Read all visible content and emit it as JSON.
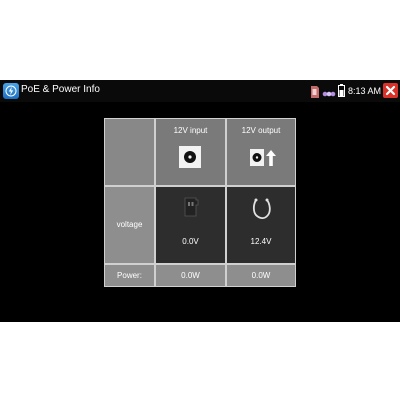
{
  "window": {
    "title": "PoE & Power Info"
  },
  "status_bar": {
    "icons": [
      "sd-card-icon",
      "network-icon",
      "battery-icon"
    ],
    "time": "8:13 AM"
  },
  "close_button": {
    "icon": "close-icon",
    "color": "#d9322a"
  },
  "table": {
    "columns": [
      "12V input",
      "12V output"
    ],
    "rows": [
      {
        "label": "voltage",
        "values": [
          "0.0V",
          "12.4V"
        ]
      },
      {
        "label": "Power:",
        "values": [
          "0.0W",
          "0.0W"
        ]
      }
    ]
  }
}
